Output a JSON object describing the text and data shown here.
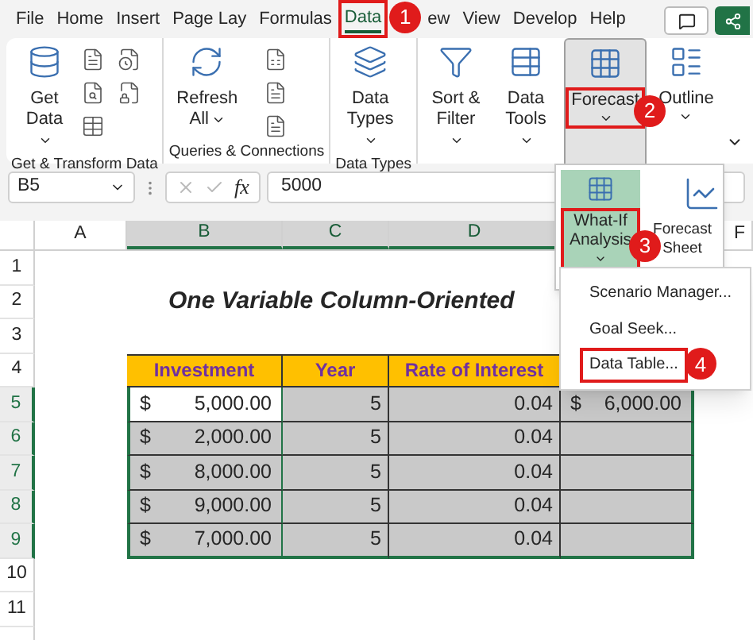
{
  "tabs": [
    {
      "label": "File",
      "selected": false,
      "highlighted": false
    },
    {
      "label": "Home",
      "selected": false,
      "highlighted": false
    },
    {
      "label": "Insert",
      "selected": false,
      "highlighted": false
    },
    {
      "label": "Page Lay",
      "selected": false,
      "highlighted": false
    },
    {
      "label": "Formulas",
      "selected": false,
      "highlighted": false
    },
    {
      "label": "Data",
      "selected": true,
      "highlighted": true,
      "step": "1"
    },
    {
      "label": "ew",
      "selected": false,
      "highlighted": false
    },
    {
      "label": "View",
      "selected": false,
      "highlighted": false
    },
    {
      "label": "Develop",
      "selected": false,
      "highlighted": false
    },
    {
      "label": "Help",
      "selected": false,
      "highlighted": false
    }
  ],
  "ribbon_groups": [
    {
      "label": "Get & Transform Data",
      "commands": [
        {
          "label": "Get Data",
          "kind": "get-data",
          "expanded": false,
          "highlighted": false
        }
      ]
    },
    {
      "label": "Queries & Connections",
      "commands": [
        {
          "label": "Refresh All",
          "kind": "refresh",
          "expanded": false,
          "highlighted": false
        }
      ]
    },
    {
      "label": "Data Types",
      "commands": [
        {
          "label": "Data Types",
          "kind": "data-types",
          "expanded": false,
          "highlighted": false
        }
      ]
    },
    {
      "commands": [
        {
          "label": "Sort & Filter",
          "kind": "sort-filter",
          "expanded": false,
          "highlighted": false
        },
        {
          "label": "Data Tools",
          "kind": "data-tools",
          "expanded": false,
          "highlighted": false
        },
        {
          "label": "Forecast",
          "kind": "forecast",
          "expanded": true,
          "highlighted": true,
          "step": "2",
          "menu": [
            {
              "label": "What-If Analysis",
              "kind": "what-if",
              "expanded": true,
              "highlighted": true,
              "step": "3",
              "submenu": [
                {
                  "label": "Scenario Manager...",
                  "highlighted": false
                },
                {
                  "label": "Goal Seek...",
                  "highlighted": false
                },
                {
                  "label": "Data Table...",
                  "highlighted": true,
                  "step": "4"
                }
              ]
            },
            {
              "label": "Forecast Sheet",
              "kind": "forecast-sheet",
              "expanded": false,
              "highlighted": false
            }
          ]
        },
        {
          "label": "Outline",
          "kind": "outline",
          "expanded": false,
          "highlighted": false
        }
      ]
    }
  ],
  "formula_bar": {
    "name_box": "B5",
    "function_label": "fx",
    "formula": "5000"
  },
  "sheet": {
    "columns": [
      {
        "label": "A",
        "selected": false
      },
      {
        "label": "B",
        "selected": true
      },
      {
        "label": "C",
        "selected": true
      },
      {
        "label": "D",
        "selected": true
      },
      {
        "label": "F",
        "selected": false
      }
    ],
    "rows": [
      {
        "number": "1",
        "selected": false
      },
      {
        "number": "2",
        "selected": false
      },
      {
        "number": "3",
        "selected": false
      },
      {
        "number": "4",
        "selected": false
      },
      {
        "number": "5",
        "selected": true
      },
      {
        "number": "6",
        "selected": true
      },
      {
        "number": "7",
        "selected": true
      },
      {
        "number": "8",
        "selected": true
      },
      {
        "number": "9",
        "selected": true
      },
      {
        "number": "10",
        "selected": false
      },
      {
        "number": "11",
        "selected": false
      }
    ],
    "title": "One Variable Column-Oriented",
    "table": {
      "headers": [
        "Investment",
        "Year",
        "Rate of Interest"
      ],
      "rows": [
        {
          "investment_currency": "$",
          "investment": "5,000.00",
          "year": "5",
          "rate": "0.04",
          "result_currency": "$",
          "result": "6,000.00",
          "active": true
        },
        {
          "investment_currency": "$",
          "investment": "2,000.00",
          "year": "5",
          "rate": "0.04",
          "active": false
        },
        {
          "investment_currency": "$",
          "investment": "8,000.00",
          "year": "5",
          "rate": "0.04",
          "active": false
        },
        {
          "investment_currency": "$",
          "investment": "9,000.00",
          "year": "5",
          "rate": "0.04",
          "active": false
        },
        {
          "investment_currency": "$",
          "investment": "7,000.00",
          "year": "5",
          "rate": "0.04",
          "active": false
        }
      ]
    }
  }
}
